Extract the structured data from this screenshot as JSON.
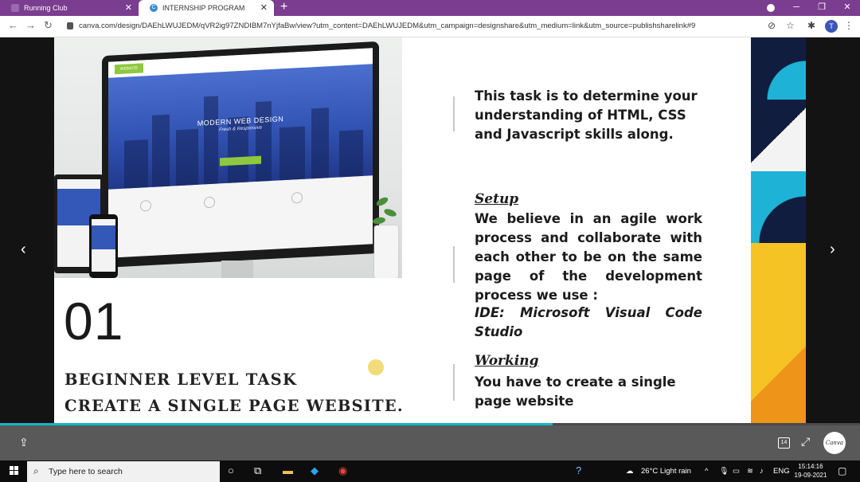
{
  "browser": {
    "tabs": [
      {
        "label": "Running Club"
      },
      {
        "label": "INTERNSHIP PROGRAM"
      }
    ],
    "url": "canva.com/design/DAEhLWUJEDM/qVR2ig97ZNDIBM7nYjfaBw/view?utm_content=DAEhLWUJEDM&utm_campaign=designshare&utm_medium=link&utm_source=publishsharelink#9",
    "profile_initial": "T"
  },
  "slide": {
    "number": "01",
    "title_line1": "BEGINNER LEVEL TASK",
    "title_line2": "CREATE A SINGLE PAGE WEBSITE.",
    "intro": "This task is to determine your understanding  of HTML, CSS and Javascript skills along.",
    "setup_heading": "Setup ",
    "setup_text": "We believe in an agile work process and collaborate with each other to be on the same page of the development process we use :",
    "ide_text": "IDE: Microsoft Visual Code Studio",
    "working_heading": "Working ",
    "working_text": "You have to create a single page website",
    "photo": {
      "hero_title": "MODERN WEB DESIGN",
      "hero_subtitle": "Fresh & Responsive",
      "nav_label": "WEBSITE"
    }
  },
  "viewer": {
    "page_badge": "14",
    "canva_logo": "Canva",
    "progress": 0.643
  },
  "taskbar": {
    "search_placeholder": "Type here to search",
    "weather": "26°C  Light rain",
    "lang": "ENG",
    "time": "15:14:16",
    "date": "19-09-2021"
  },
  "colors": {
    "tabstrip": "#7a3d8f",
    "progress": "#12b6c4",
    "accent_green": "#8fc73e",
    "hero_blue": "#3153b4"
  }
}
